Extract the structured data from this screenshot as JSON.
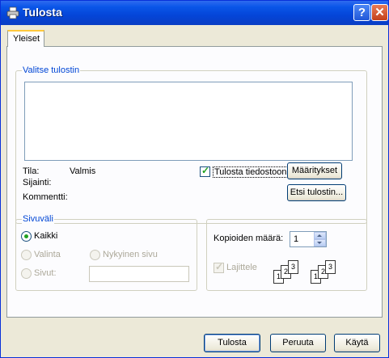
{
  "window": {
    "title": "Tulosta"
  },
  "tabs": [
    {
      "label": "Yleiset"
    }
  ],
  "printer_group": {
    "legend": "Valitse tulostin",
    "status_label": "Tila:",
    "status_value": "Valmis",
    "location_label": "Sijainti:",
    "comment_label": "Kommentti:",
    "print_to_file_label": "Tulosta tiedostoon",
    "print_to_file_checked": true,
    "properties_button": "Määritykset",
    "find_printer_button": "Etsi tulostin..."
  },
  "page_range_group": {
    "legend": "Sivuväli",
    "all_label": "Kaikki",
    "selection_label": "Valinta",
    "current_page_label": "Nykyinen sivu",
    "pages_label": "Sivut:"
  },
  "copies_group": {
    "copies_label": "Kopioiden määrä:",
    "copies_value": "1",
    "collate_label": "Lajittele",
    "collate_checked": true,
    "collate_pages": [
      "1",
      "2",
      "3",
      "1",
      "2",
      "3"
    ]
  },
  "buttons": {
    "print": "Tulosta",
    "cancel": "Peruuta",
    "apply": "Käytä"
  }
}
